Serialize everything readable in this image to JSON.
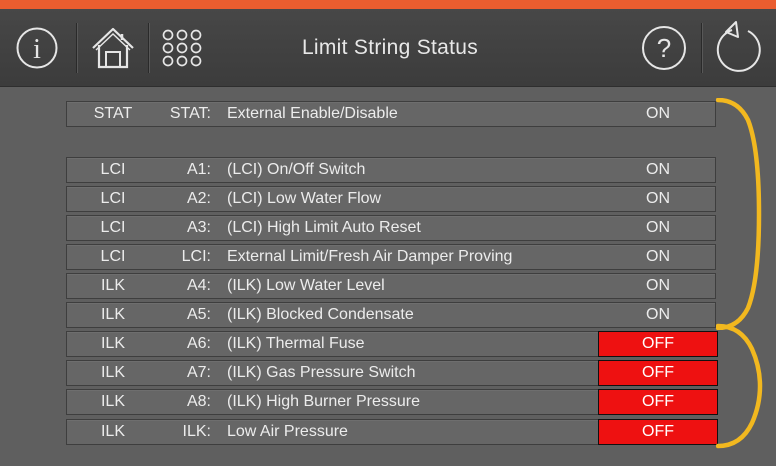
{
  "header": {
    "title": "Limit String Status",
    "buttons": [
      "info-icon",
      "home-icon",
      "menu-grid-icon",
      "help-icon",
      "back-icon"
    ]
  },
  "rows": [
    {
      "type": "STAT",
      "code": "STAT:",
      "description": "External Enable/Disable",
      "status": "ON"
    },
    {
      "type": "LCI",
      "code": "A1:",
      "description": "(LCI) On/Off Switch",
      "status": "ON"
    },
    {
      "type": "LCI",
      "code": "A2:",
      "description": "(LCI) Low Water Flow",
      "status": "ON"
    },
    {
      "type": "LCI",
      "code": "A3:",
      "description": "(LCI) High Limit Auto Reset",
      "status": "ON"
    },
    {
      "type": "LCI",
      "code": "LCI:",
      "description": "External Limit/Fresh Air Damper Proving",
      "status": "ON"
    },
    {
      "type": "ILK",
      "code": "A4:",
      "description": "(ILK) Low Water Level",
      "status": "ON"
    },
    {
      "type": "ILK",
      "code": "A5:",
      "description": "(ILK) Blocked Condensate",
      "status": "ON"
    },
    {
      "type": "ILK",
      "code": "A6:",
      "description": "(ILK) Thermal Fuse",
      "status": "OFF"
    },
    {
      "type": "ILK",
      "code": "A7:",
      "description": "(ILK) Gas Pressure Switch",
      "status": "OFF"
    },
    {
      "type": "ILK",
      "code": "A8:",
      "description": "(ILK) High Burner Pressure",
      "status": "OFF"
    },
    {
      "type": "ILK",
      "code": "ILK:",
      "description": "Low Air Pressure",
      "status": "OFF"
    }
  ],
  "colors": {
    "accent_strip": "#ea5d2f",
    "off_background": "#ee1111",
    "bracket": "#f2b81f",
    "background": "#5f5f5f"
  }
}
